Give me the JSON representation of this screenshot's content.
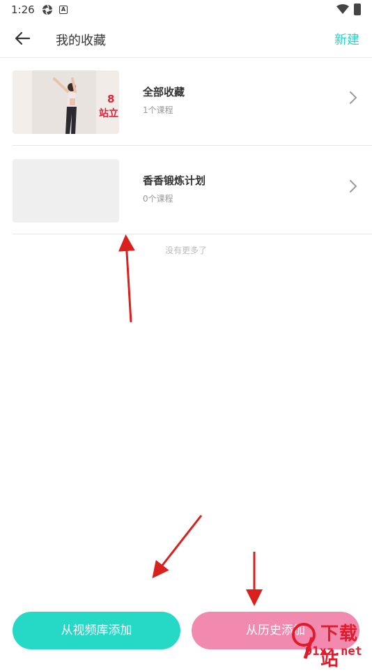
{
  "status_bar": {
    "time": "1:26",
    "icons": [
      "aperture-icon",
      "a-badge-icon",
      "wifi-icon",
      "battery-charging-icon"
    ]
  },
  "header": {
    "back_icon": "arrow-left-icon",
    "title": "我的收藏",
    "new_label": "新建"
  },
  "collections": [
    {
      "title": "全部收藏",
      "count": "1个课程",
      "has_thumbnail": true,
      "thumb_text": "8 站立"
    },
    {
      "title": "香香锻炼计划",
      "count": "0个课程",
      "has_thumbnail": false
    }
  ],
  "list_end_text": "没有更多了",
  "buttons": {
    "add_from_library": "从视频库添加",
    "add_from_history": "从历史添加"
  },
  "watermark": {
    "line1": "下载站",
    "line2": "91xz.net"
  },
  "colors": {
    "accent": "#26d7c4",
    "pink_button": "#f28ab0",
    "annotation_arrow": "#d9201c"
  }
}
